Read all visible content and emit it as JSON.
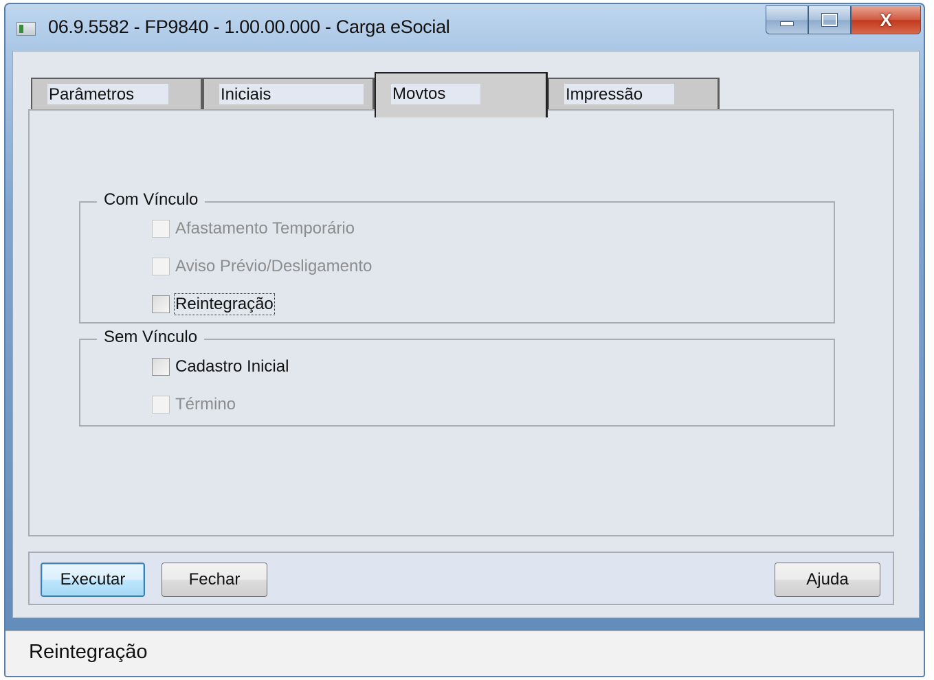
{
  "window": {
    "title": "06.9.5582 - FP9840 - 1.00.00.000 - Carga eSocial",
    "minimize_icon": "minimize-icon",
    "maximize_icon": "maximize-icon",
    "close_glyph": "X"
  },
  "tabs": [
    {
      "label": "Parâmetros",
      "active": false
    },
    {
      "label": "Iniciais",
      "active": false
    },
    {
      "label": "Movtos",
      "active": true
    },
    {
      "label": "Impressão",
      "active": false
    }
  ],
  "groups": {
    "com_vinculo": {
      "title": "Com Vínculo",
      "items": [
        {
          "label": "Afastamento Temporário",
          "checked": false,
          "enabled": false
        },
        {
          "label": "Aviso Prévio/Desligamento",
          "checked": false,
          "enabled": false
        },
        {
          "label": "Reintegração",
          "checked": false,
          "enabled": true
        }
      ]
    },
    "sem_vinculo": {
      "title": "Sem Vínculo",
      "items": [
        {
          "label": "Cadastro Inicial",
          "checked": false,
          "enabled": true
        },
        {
          "label": "Término",
          "checked": false,
          "enabled": false
        }
      ]
    }
  },
  "buttons": {
    "execute": "Executar",
    "close": "Fechar",
    "help": "Ajuda"
  },
  "status": {
    "text": "Reintegração"
  }
}
